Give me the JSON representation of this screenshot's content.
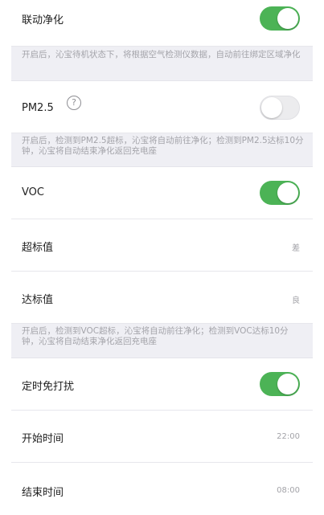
{
  "linkage": {
    "label": "联动净化",
    "enabled": true,
    "note": "开启后，沁宝待机状态下，将根据空气检测仪数据，自动前往绑定区域净化"
  },
  "pm25": {
    "label": "PM2.5",
    "help_icon": "question-circle-icon",
    "help_glyph": "?",
    "enabled": false,
    "note": "开启后，检测到PM2.5超标，沁宝将自动前往净化；检测到PM2.5达标10分钟，沁宝将自动结束净化返回充电座"
  },
  "voc": {
    "label": "VOC",
    "enabled": true,
    "exceed_label": "超标值",
    "exceed_value": "差",
    "meet_label": "达标值",
    "meet_value": "良",
    "note": "开启后，检测到VOC超标，沁宝将自动前往净化；检测到VOC达标10分钟，沁宝将自动结束净化返回充电座"
  },
  "dnd": {
    "label": "定时免打扰",
    "enabled": true,
    "start_label": "开始时间",
    "start_value": "22:00",
    "end_label": "结束时间",
    "end_value": "08:00"
  },
  "colors": {
    "toggle_on": "#4cb356",
    "toggle_off": "#ececee",
    "note_background": "#efeff4"
  }
}
